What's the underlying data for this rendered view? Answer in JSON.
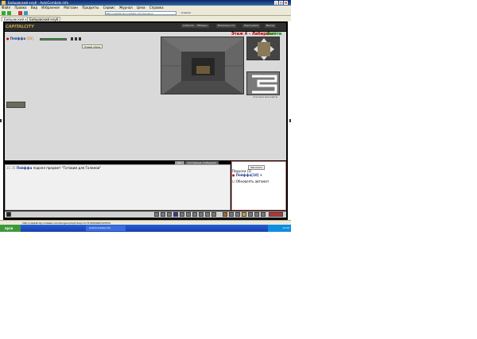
{
  "window": {
    "title": "Бойцовский клуб - AutoCombats.info"
  },
  "menu": [
    "Файл",
    "Правка",
    "Вид",
    "Избранное",
    "Магазин",
    "Продукты",
    "Сервис",
    "Журнал",
    "Цена",
    "Справка"
  ],
  "toolbar": {
    "address_url": "http://capitalcity.combats.com/dungeon",
    "links_label": "Ссылки"
  },
  "tabs": [
    "Бойцовский клуб",
    "Бойцовский клуб"
  ],
  "game": {
    "logo": "CAPITALCITY",
    "nav": [
      "Событие",
      "Обмены",
      "Возможности",
      "Персонажи",
      "Выход"
    ],
    "level_title": "Этаж 4 - Лабиринт",
    "exit_label": "Выйти",
    "player": {
      "name": "Пейффа",
      "level": "[10]"
    },
    "tooltip": "Новый образ",
    "map_caption": "отогнуть все карты"
  },
  "chat": {
    "tabs": [
      "Чат",
      "Системные сообщения"
    ],
    "line": {
      "time": "11:35",
      "who": "Пейффа",
      "text": "поднял предмет \"Готовим для Големов\""
    }
  },
  "right_panel": {
    "refresh_label": "Обновить",
    "nearby_label": "Поруска (1)",
    "nearby_player": "Пейффа[10]",
    "auto_label": "Обновлять автомат."
  },
  "status_bar": {
    "url": "http://capitalcity.combats.com/dungeon/dl.pl?loop=0.7374559967415554"
  },
  "taskbar": {
    "start": "пуск",
    "item": "AutoCombats.info",
    "clock": "14:26"
  }
}
